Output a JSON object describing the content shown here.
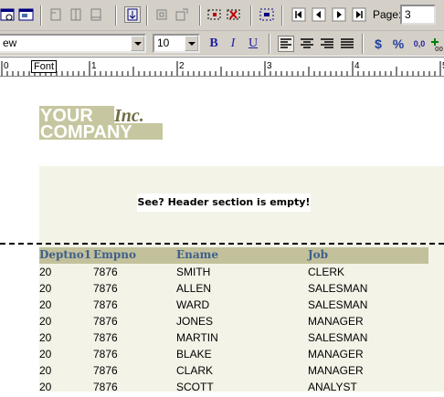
{
  "toolbar": {
    "page_label": "Page:",
    "page_value": "3"
  },
  "format_bar": {
    "font_name": "ew",
    "font_size": "10",
    "bold_label": "B",
    "italic_label": "I",
    "underline_label": "U",
    "currency_label": "$",
    "percent_label": "%",
    "decimal_label": "0,0"
  },
  "ruler": {
    "font_tag": "Font",
    "labels": [
      "0",
      "1",
      "2",
      "3",
      "4",
      "5"
    ]
  },
  "report": {
    "logo_line1": "YOUR",
    "logo_inc": "Inc.",
    "logo_line2": "COMPANY",
    "header_note": "See? Header section is empty!",
    "columns": [
      "Deptno1",
      "Empno",
      "Ename",
      "Job"
    ],
    "rows": [
      [
        "20",
        "7876",
        "SMITH",
        "CLERK"
      ],
      [
        "20",
        "7876",
        "ALLEN",
        "SALESMAN"
      ],
      [
        "20",
        "7876",
        "WARD",
        "SALESMAN"
      ],
      [
        "20",
        "7876",
        "JONES",
        "MANAGER"
      ],
      [
        "20",
        "7876",
        "MARTIN",
        "SALESMAN"
      ],
      [
        "20",
        "7876",
        "BLAKE",
        "MANAGER"
      ],
      [
        "20",
        "7876",
        "CLARK",
        "MANAGER"
      ],
      [
        "20",
        "7876",
        "SCOTT",
        "ANALYST"
      ]
    ]
  }
}
